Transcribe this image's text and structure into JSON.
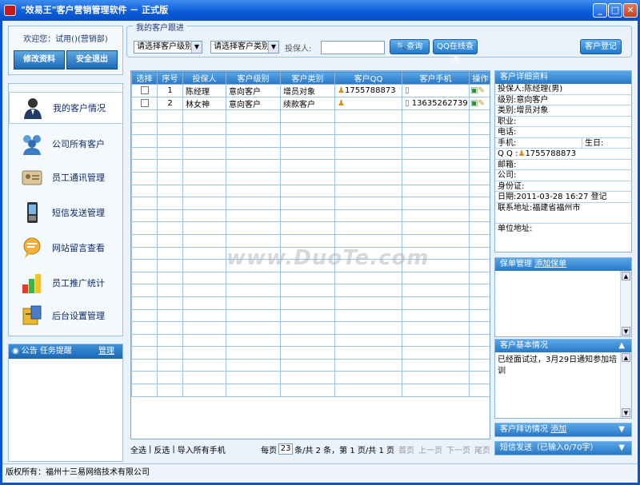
{
  "window": {
    "title": "\"效易王\"客户营销管理软件 － 正式版",
    "min": "_",
    "max": "□",
    "close": "✕"
  },
  "user": {
    "welcome": "欢迎您：试用()(营销部)",
    "edit_btn": "修改资料",
    "logout_btn": "安全退出"
  },
  "nav": {
    "items": [
      {
        "label": "我的客户情况",
        "icon": "user-icon",
        "active": true
      },
      {
        "label": "公司所有客户",
        "icon": "users-group-icon",
        "active": false
      },
      {
        "label": "员工通讯管理",
        "icon": "contact-card-icon",
        "active": false
      },
      {
        "label": "短信发送管理",
        "icon": "mobile-phone-icon",
        "active": false
      },
      {
        "label": "网站留言查看",
        "icon": "message-board-icon",
        "active": false
      },
      {
        "label": "员工推广统计",
        "icon": "bar-chart-icon",
        "active": false
      },
      {
        "label": "后台设置管理",
        "icon": "settings-box-icon",
        "active": false
      }
    ]
  },
  "notice": {
    "title": "公告 任务提醒",
    "manage": "管理"
  },
  "filter": {
    "title": "我的客户跟进",
    "level_select": "请选择客户级别",
    "type_select": "请选择客户类别",
    "agent_label": "投保人:",
    "agent_value": "",
    "query_btn": "查询",
    "qq_btn": "QQ在线查询",
    "register_btn": "客户登记"
  },
  "table": {
    "columns": [
      "选择",
      "序号",
      "投保人",
      "客户级别",
      "客户类别",
      "客户QQ",
      "客户手机",
      "操作"
    ],
    "rows": [
      {
        "no": "1",
        "agent": "陈经理",
        "level": "意向客户",
        "type": "增员对象",
        "qq": "1755788873",
        "phone": ""
      },
      {
        "no": "2",
        "agent": "林女神",
        "level": "意向客户",
        "type": "续款客户",
        "qq": "",
        "phone": "13635262739"
      }
    ],
    "empty_rows": 23
  },
  "footer": {
    "select_all": "全选",
    "invert": "反选",
    "import": "导入所有手机",
    "per_page_label": "每页",
    "per_page": "23",
    "summary": "条/共 2 条，第 1 页/共 1 页",
    "first": "首页",
    "prev": "上一页",
    "next": "下一页",
    "last": "尾页"
  },
  "detail": {
    "title": "客户详细资料",
    "agent": "投保人:陈经理(男)",
    "level": "级别:意向客户",
    "type": "类别:增员对象",
    "job": "职业:",
    "tel": "电话:",
    "mobile": "手机:",
    "birthday": "生日:",
    "qq_label": "Q Q :",
    "qq": "1755788873",
    "email": "邮箱:",
    "company": "公司:",
    "id": "身份证:",
    "date": "日期:2011-03-28 16:27 登记",
    "address": "联系地址:福建省福州市",
    "unit_address": "单位地址:"
  },
  "policy": {
    "title": "保单管理",
    "add": "添加保单"
  },
  "basic": {
    "title": "客户基本情况",
    "text": "已经面试过，3月29日通知参加培训"
  },
  "visit": {
    "title": "客户拜访情况",
    "add": "添加"
  },
  "sms": {
    "title": "短信发送（已输入0/70字）"
  },
  "status": "版权所有：福州十三易网络技术有限公司",
  "watermark": "www.DuoTe.com"
}
